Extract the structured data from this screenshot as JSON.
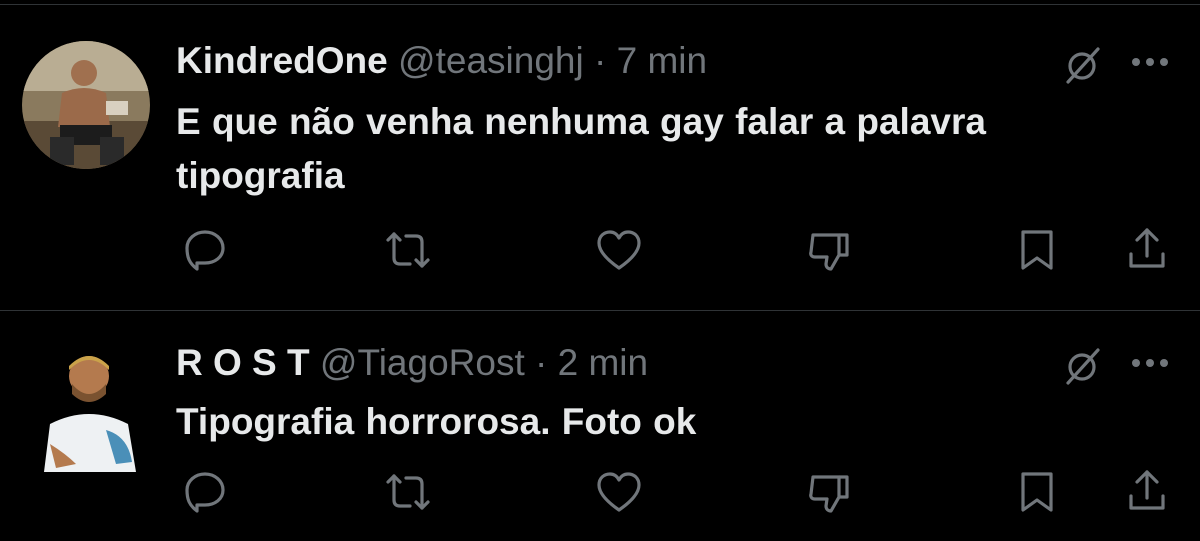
{
  "tweets": [
    {
      "display_name": "KindredOne",
      "handle": "@teasinghj",
      "separator": " · ",
      "time": "7 min",
      "text_lines": [
        "E que não venha nenhuma gay falar a palavra",
        "tipografia"
      ],
      "icons": [
        "grok-icon",
        "more-icon",
        "reply-icon",
        "retweet-icon",
        "like-icon",
        "dislike-icon",
        "bookmark-icon",
        "share-icon"
      ]
    },
    {
      "display_name": "R O S T",
      "handle": "@TiagoRost",
      "separator": " · ",
      "time": "2 min",
      "text_lines": [
        "Tipografia horrorosa. Foto ok"
      ],
      "icons": [
        "grok-icon",
        "more-icon",
        "reply-icon",
        "retweet-icon",
        "like-icon",
        "dislike-icon",
        "bookmark-icon",
        "share-icon"
      ]
    }
  ],
  "colors": {
    "background": "#000000",
    "text": "#e7e9ea",
    "secondary": "#71767b",
    "divider": "#2f3336"
  }
}
